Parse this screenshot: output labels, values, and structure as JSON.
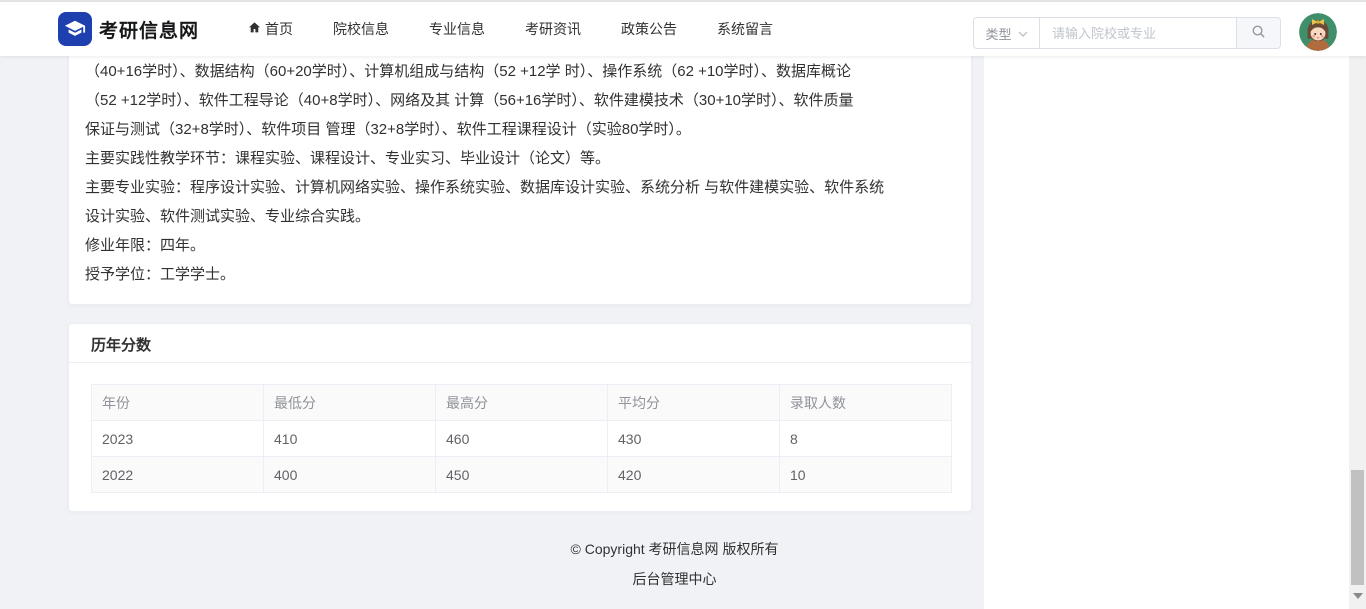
{
  "navbar": {
    "brand": "考研信息网",
    "items": [
      {
        "label": "首页"
      },
      {
        "label": "院校信息"
      },
      {
        "label": "专业信息"
      },
      {
        "label": "考研资讯"
      },
      {
        "label": "政策公告"
      },
      {
        "label": "系统留言"
      }
    ],
    "search": {
      "type_label": "类型",
      "placeholder": "请输入院校或专业"
    }
  },
  "content": {
    "lines": [
      "（40+16学时）、数据结构（60+20学时）、计算机组成与结构（52 +12学 时）、操作系统（62 +10学时）、数据库概论",
      "（52 +12学时）、软件工程导论（40+8学时）、网络及其 计算（56+16学时）、软件建模技术（30+10学时）、软件质量",
      "保证与测试（32+8学时）、软件项目 管理（32+8学时）、软件工程课程设计（实验80学时）。",
      "主要实践性教学环节：课程实验、课程设计、专业实习、毕业设计（论文）等。",
      "主要专业实验：程序设计实验、计算机网络实验、操作系统实验、数据库设计实验、系统分析 与软件建模实验、软件系统",
      "设计实验、软件测试实验、专业综合实践。",
      "修业年限：四年。",
      "授予学位：工学学士。"
    ]
  },
  "scores": {
    "title": "历年分数",
    "table": {
      "headers": [
        "年份",
        "最低分",
        "最高分",
        "平均分",
        "录取人数"
      ],
      "rows": [
        [
          "2023",
          "410",
          "460",
          "430",
          "8"
        ],
        [
          "2022",
          "400",
          "450",
          "420",
          "10"
        ]
      ]
    }
  },
  "footer": {
    "copyright": "© Copyright 考研信息网 版权所有",
    "admin": "后台管理中心"
  },
  "icons": {
    "logo": "graduation-cap-icon",
    "home": "home-icon",
    "chevron": "chevron-down-icon",
    "search": "search-icon",
    "avatar": "user-avatar"
  },
  "colors": {
    "brand_blue": "#1e40af",
    "page_bg": "#f0f2f5",
    "table_header_bg": "#fafafa",
    "card_border": "#ebeef5",
    "text_primary": "#303133",
    "text_secondary": "#606266",
    "text_muted": "#909399",
    "avatar_green": "#3f8f6a"
  }
}
